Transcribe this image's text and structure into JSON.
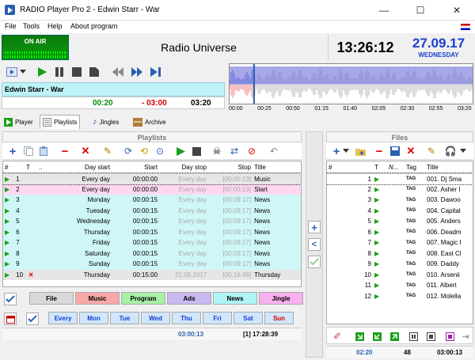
{
  "window": {
    "title": "RADIO Player Pro 2 - Edwin Starr - War",
    "min": "—",
    "max": "☐",
    "close": "✕"
  },
  "menu": [
    "File",
    "Tools",
    "Help",
    "About program"
  ],
  "onair": "ON AIR",
  "station": "Radio Universe",
  "clock": "13:26:12",
  "date": "27.09.17",
  "weekday": "WEDNESDAY",
  "player": {
    "track": "Edwin Starr - War",
    "elapsed": "00:20",
    "remaining": "- 03:00",
    "total": "03:20",
    "position_fraction": 0.1
  },
  "wave_ticks": [
    "00:00",
    "00:25",
    "00:50",
    "01:15",
    "01:40",
    "02:05",
    "02:30",
    "02:55",
    "03:20"
  ],
  "tabs": [
    "Player",
    "Playlists",
    "Jingles",
    "Archive"
  ],
  "playlists": {
    "header": "Playlists",
    "columns": [
      "#",
      "T",
      "..",
      "Day start",
      "Start",
      "Day stop",
      "Stop",
      "Title"
    ],
    "rows": [
      {
        "n": "1",
        "t": "",
        "day_start": "Every day",
        "start": "00:00:00",
        "day_stop": "Every day",
        "stop": "[00:00:13]",
        "title": "Music",
        "bg": "#e6e6e6",
        "sel": true
      },
      {
        "n": "2",
        "t": "",
        "day_start": "Every day",
        "start": "00:00:00",
        "day_stop": "Every day",
        "stop": "[00:00:13]",
        "title": "Start",
        "bg": "#ffd8f0"
      },
      {
        "n": "3",
        "t": "",
        "day_start": "Monday",
        "start": "00:00:15",
        "day_stop": "Every day",
        "stop": "[00:09:17]",
        "title": "News",
        "bg": "#cff7f7"
      },
      {
        "n": "4",
        "t": "",
        "day_start": "Tuesday",
        "start": "00:00:15",
        "day_stop": "Every day",
        "stop": "[00:09:17]",
        "title": "News",
        "bg": "#cff7f7"
      },
      {
        "n": "5",
        "t": "",
        "day_start": "Wednesday",
        "start": "00:00:15",
        "day_stop": "Every day",
        "stop": "[00:09:17]",
        "title": "News",
        "bg": "#cff7f7"
      },
      {
        "n": "6",
        "t": "",
        "day_start": "Thursday",
        "start": "00:00:15",
        "day_stop": "Every day",
        "stop": "[00:09:17]",
        "title": "News",
        "bg": "#cff7f7"
      },
      {
        "n": "7",
        "t": "",
        "day_start": "Friday",
        "start": "00:00:15",
        "day_stop": "Every day",
        "stop": "[00:09:17]",
        "title": "News",
        "bg": "#cff7f7"
      },
      {
        "n": "8",
        "t": "",
        "day_start": "Saturday",
        "start": "00:00:15",
        "day_stop": "Every day",
        "stop": "[00:09:17]",
        "title": "News",
        "bg": "#cff7f7"
      },
      {
        "n": "9",
        "t": "",
        "day_start": "Sunday",
        "start": "00:00:15",
        "day_stop": "Every day",
        "stop": "[00:09:17]",
        "title": "News",
        "bg": "#cff7f7"
      },
      {
        "n": "10",
        "t": "✕",
        "day_start": "Thursday",
        "start": "00:15:00",
        "day_stop": "21.09.2017",
        "stop": "[00:16:46]",
        "title": "Thursday",
        "bg": "#e6e6e6"
      }
    ]
  },
  "categories": [
    {
      "label": "File",
      "bg": "#d9d9d9"
    },
    {
      "label": "Music",
      "bg": "#f7a8a8"
    },
    {
      "label": "Program",
      "bg": "#a8f0a8"
    },
    {
      "label": "Ads",
      "bg": "#c8b8f0"
    },
    {
      "label": "News",
      "bg": "#b0f4f4"
    },
    {
      "label": "Jingle",
      "bg": "#f8b0f0"
    }
  ],
  "days": [
    "Every",
    "Mon",
    "Tue",
    "Wed",
    "Thu",
    "Fri",
    "Sat",
    "Sun"
  ],
  "left_status": {
    "duration": "03:00:13",
    "info": "[1] 17:28:39"
  },
  "files": {
    "header": "Files",
    "columns": [
      "#",
      "T",
      "N...",
      "Tag",
      "Title"
    ],
    "rows": [
      {
        "n": "1",
        "tag": "TAG",
        "title": "001. Dj Sma"
      },
      {
        "n": "2",
        "tag": "TAG",
        "title": "002. Asher I"
      },
      {
        "n": "3",
        "tag": "TAG",
        "title": "003. Dawoo"
      },
      {
        "n": "4",
        "tag": "TAG",
        "title": "004. Capital"
      },
      {
        "n": "5",
        "tag": "TAG",
        "title": "005. Anders"
      },
      {
        "n": "6",
        "tag": "TAG",
        "title": "006. Deadm"
      },
      {
        "n": "7",
        "tag": "TAG",
        "title": "007. Magic I"
      },
      {
        "n": "8",
        "tag": "TAG",
        "title": "008. East Cl"
      },
      {
        "n": "9",
        "tag": "TAG",
        "title": "009. Daddy"
      },
      {
        "n": "10",
        "tag": "TAG",
        "title": "010. Arsenii"
      },
      {
        "n": "11",
        "tag": "TAG",
        "title": "011. Albert"
      },
      {
        "n": "12",
        "tag": "TAG",
        "title": "012. Molella"
      }
    ]
  },
  "right_status": {
    "time": "02:20",
    "count": "48",
    "duration": "03:00:13"
  },
  "colors": {
    "accent": "#1a3fd0",
    "cyan": "#bdf3f7",
    "green": "#0c9a0c",
    "red": "#d00000"
  }
}
